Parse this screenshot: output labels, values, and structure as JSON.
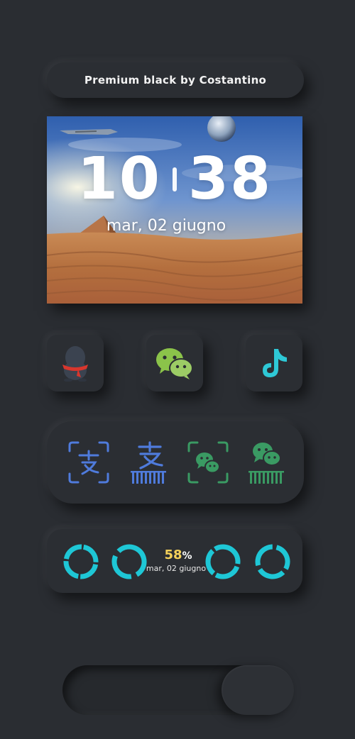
{
  "header": {
    "title": "Premium black by Costantino"
  },
  "clock_widget": {
    "hours": "10",
    "minutes": "38",
    "date": "mar, 02 giugno",
    "wallpaper": "desert-pyramid-planet-wallpaper"
  },
  "apps": [
    {
      "name": "qq",
      "icon": "qq-penguin-icon"
    },
    {
      "name": "wechat",
      "icon": "wechat-icon"
    },
    {
      "name": "tiktok",
      "icon": "tiktok-icon"
    }
  ],
  "shortcuts": [
    {
      "name": "alipay-scan",
      "icon": "alipay-scan-icon",
      "color": "#4f7bdc"
    },
    {
      "name": "alipay-pay-code",
      "icon": "alipay-barcode-icon",
      "color": "#4f7bdc"
    },
    {
      "name": "wechat-scan",
      "icon": "wechat-scan-icon",
      "color": "#3a9a63"
    },
    {
      "name": "wechat-pay-code",
      "icon": "wechat-barcode-icon",
      "color": "#3a9a63"
    }
  ],
  "stats": {
    "battery_percent": "58",
    "percent_sign": "%",
    "date": "mar, 02 giugno",
    "ring_color": "#1ec7d6"
  },
  "slider": {
    "value": 1.0
  },
  "colors": {
    "background": "#2a2d32",
    "alipay_blue": "#4f7bdc",
    "wechat_green": "#3a9a63",
    "battery_yellow": "#f4d15a",
    "ring_cyan": "#1ec7d6"
  }
}
